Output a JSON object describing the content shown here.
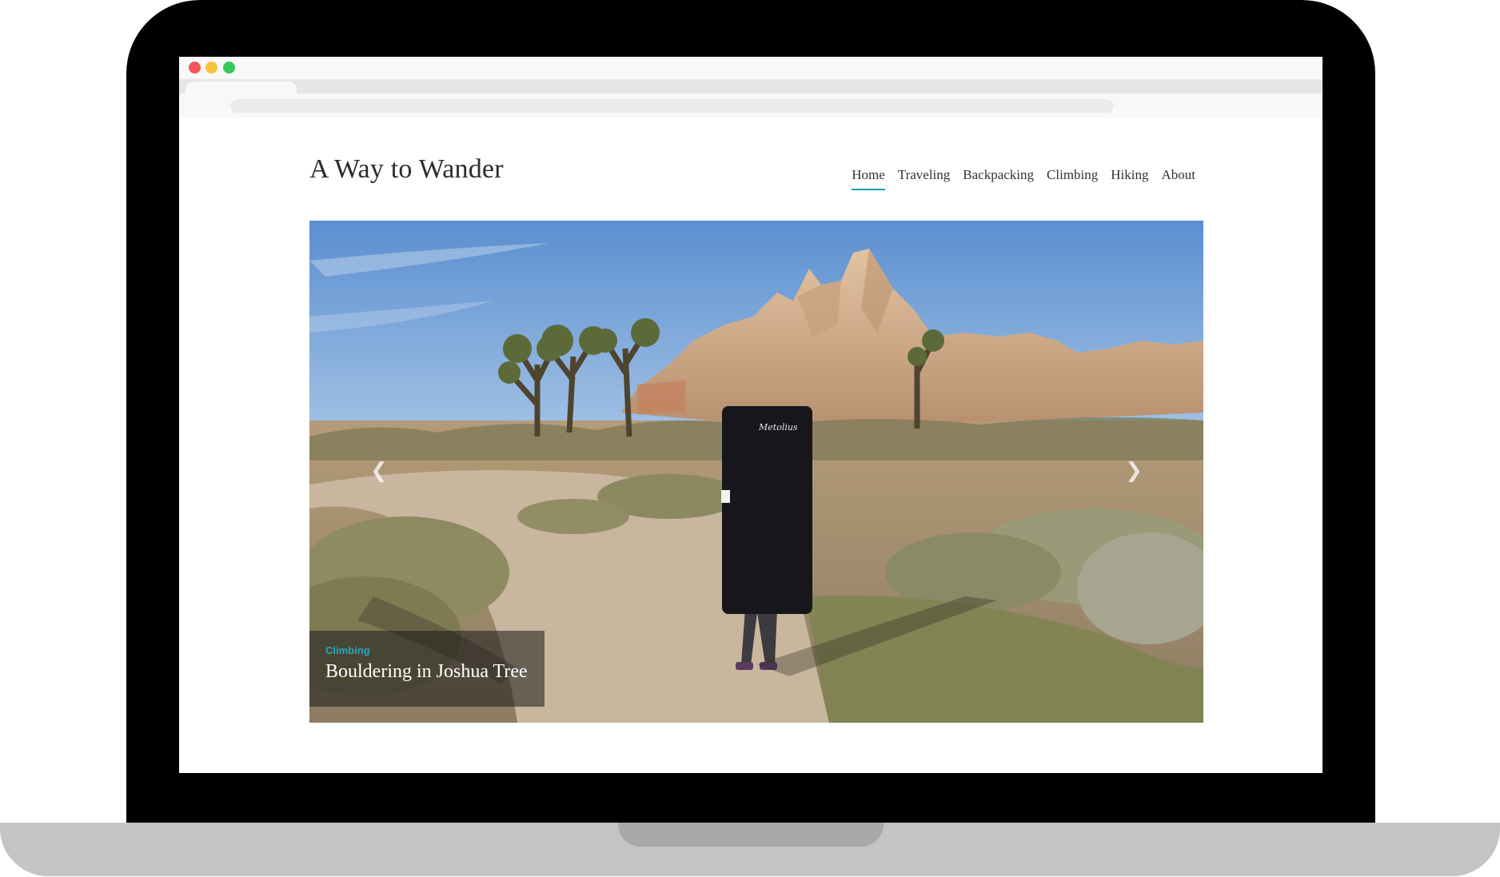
{
  "site": {
    "title": "A Way to Wander"
  },
  "nav": {
    "items": [
      {
        "label": "Home",
        "active": true
      },
      {
        "label": "Traveling",
        "active": false
      },
      {
        "label": "Backpacking",
        "active": false
      },
      {
        "label": "Climbing",
        "active": false
      },
      {
        "label": "Hiking",
        "active": false
      },
      {
        "label": "About",
        "active": false
      }
    ]
  },
  "slider": {
    "prev_icon": "chevron-left-icon",
    "next_icon": "chevron-right-icon",
    "slide": {
      "category": "Climbing",
      "title": "Bouldering in Joshua Tree"
    }
  },
  "colors": {
    "accent": "#1f9bb0",
    "category": "#2aa7bd",
    "traffic_red": "#f2545b",
    "traffic_yellow": "#f7c23c",
    "traffic_green": "#35c759",
    "device_frame": "#000000",
    "device_base": "#c4c4c4"
  }
}
